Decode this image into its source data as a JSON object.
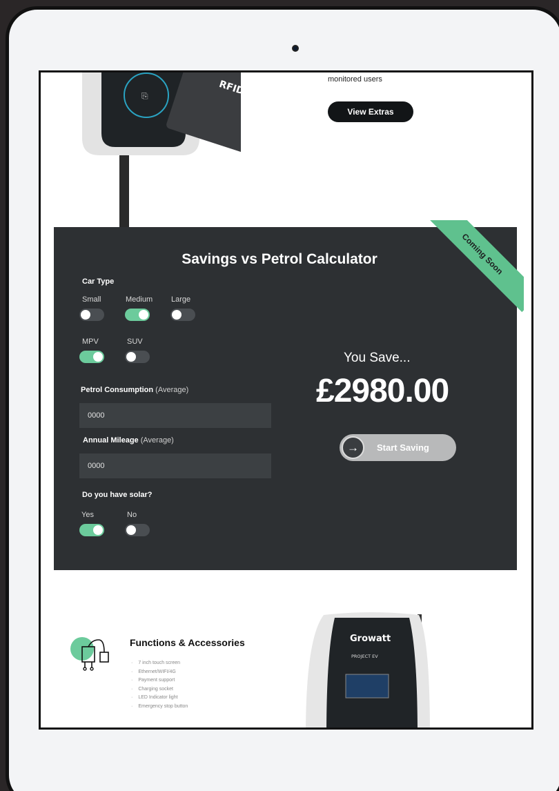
{
  "extras": {
    "text_fragment": "monitored users",
    "button_label": "View Extras"
  },
  "calculator": {
    "title": "Savings vs Petrol Calculator",
    "ribbon": "Coming Soon",
    "car_type": {
      "label": "Car Type",
      "options": [
        {
          "label": "Small",
          "on": false
        },
        {
          "label": "Medium",
          "on": true
        },
        {
          "label": "Large",
          "on": false
        },
        {
          "label": "MPV",
          "on": true
        },
        {
          "label": "SUV",
          "on": false
        }
      ]
    },
    "petrol": {
      "label": "Petrol Consumption",
      "qualifier": "(Average)",
      "value": "0000"
    },
    "mileage": {
      "label": "Annual Mileage",
      "qualifier": "(Average)",
      "value": "0000"
    },
    "solar": {
      "label": "Do you have solar?",
      "options": [
        {
          "label": "Yes",
          "on": true
        },
        {
          "label": "No",
          "on": false
        }
      ]
    },
    "you_save": "You Save...",
    "amount": "£2980.00",
    "cta": "Start Saving"
  },
  "functions": {
    "title": "Functions & Accessories",
    "items": [
      "7 inch touch screen",
      "Ethernet/WIFI/4G",
      "Payment support",
      "Charging socket",
      "LED Indicator light",
      "Emergency stop button"
    ]
  },
  "charger_brand": {
    "logo": "Growatt",
    "sub": "PROJECT EV"
  },
  "colors": {
    "accent": "#6ccb9c",
    "panel": "#2d3033",
    "button_dark": "#121517"
  }
}
